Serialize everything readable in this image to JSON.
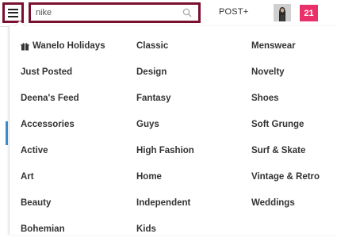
{
  "header": {
    "search_value": "nike",
    "post_label": "POST+",
    "notification_count": "21",
    "accent_color": "#7a1030",
    "badge_color": "#e8306a"
  },
  "menu": {
    "columns": [
      [
        {
          "label": "Wanelo Holidays",
          "icon": "gift-icon"
        },
        {
          "label": "Just Posted"
        },
        {
          "label": "Deena's Feed"
        },
        {
          "label": "Accessories"
        },
        {
          "label": "Active"
        },
        {
          "label": "Art"
        },
        {
          "label": "Beauty"
        },
        {
          "label": "Bohemian"
        }
      ],
      [
        {
          "label": "Classic"
        },
        {
          "label": "Design"
        },
        {
          "label": "Fantasy"
        },
        {
          "label": "Guys"
        },
        {
          "label": "High Fashion"
        },
        {
          "label": "Home"
        },
        {
          "label": "Independent"
        },
        {
          "label": "Kids"
        }
      ],
      [
        {
          "label": "Menswear"
        },
        {
          "label": "Novelty"
        },
        {
          "label": "Shoes"
        },
        {
          "label": "Soft Grunge"
        },
        {
          "label": "Surf & Skate"
        },
        {
          "label": "Vintage & Retro"
        },
        {
          "label": "Weddings"
        }
      ]
    ]
  }
}
